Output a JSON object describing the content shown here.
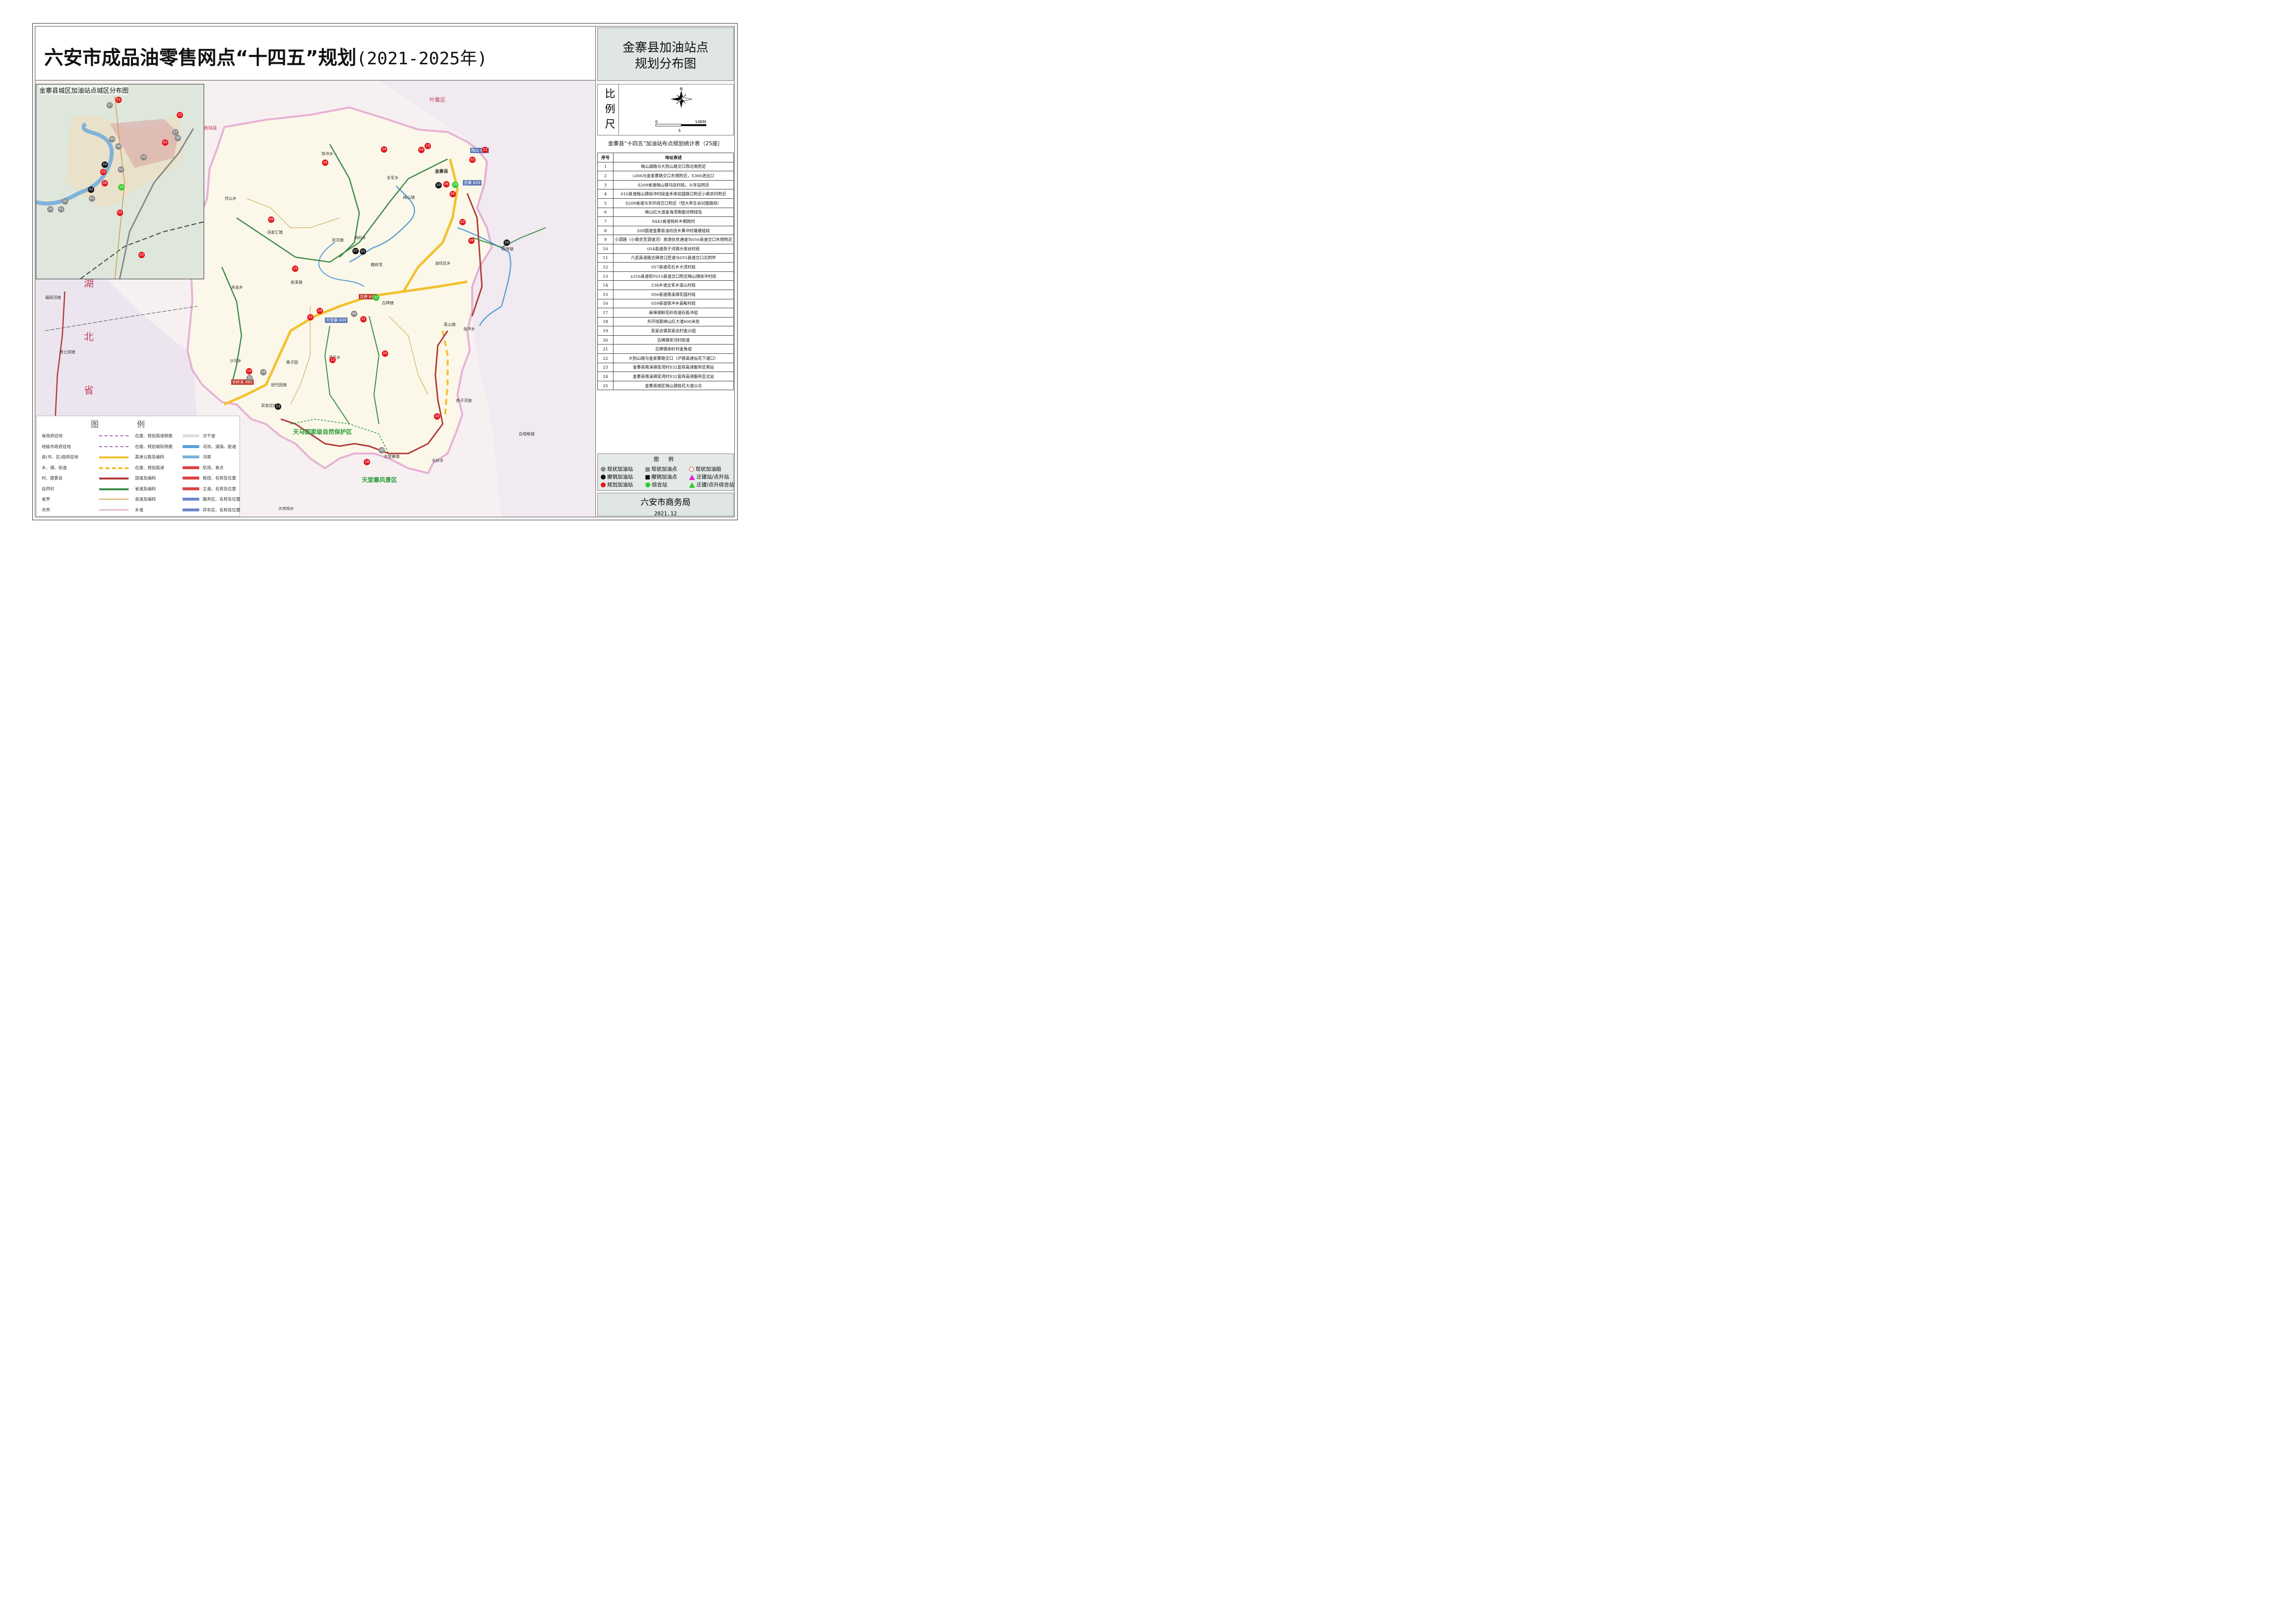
{
  "header": {
    "title": "六安市成品油零售网点“十四五”规划",
    "title_years": "(2021-2025年)",
    "panel_title_line1": "金寨县加油站点",
    "panel_title_line2": "规划分布图"
  },
  "scale": {
    "label_chars": [
      "比",
      "例",
      "尺"
    ],
    "north": "N",
    "ticks": [
      "0",
      "5",
      "10KM"
    ]
  },
  "stats_table": {
    "title": "金寨县“十四五”加油站布点规划统计表（25座）",
    "col_no": "序号",
    "col_addr": "地址表述",
    "rows": [
      {
        "no": "1",
        "addr": "梅山湖路与大别山路交口西北角附近"
      },
      {
        "no": "2",
        "addr": "s366与金家寨路交口东侧附近，S366进出口"
      },
      {
        "no": "3",
        "addr": "S209省道梅山镇马店村段，火车站附近"
      },
      {
        "no": "4",
        "addr": "010县道梅山镇徐冲村段金禾体验园路口附近小南京村附近"
      },
      {
        "no": "5",
        "addr": "S209省道与东环线交口附近（恒大养生谷对面路段）"
      },
      {
        "no": "6",
        "addr": "映山红大道金海湾南面对侧绿岛"
      },
      {
        "no": "7",
        "addr": "S443省道桃岭乡桐岗村"
      },
      {
        "no": "8",
        "addr": "209国道金寨县油坊店乡黄冲村塘埂组段"
      },
      {
        "no": "9",
        "addr": "小泗路（小南京至泗道河）旅游扶贫通道与056县道交口东侧附近"
      },
      {
        "no": "10",
        "addr": "054县道燕子河镇大侠谷村段"
      },
      {
        "no": "11",
        "addr": "六武高速路古碑进口匝道与055县道交口北附件"
      },
      {
        "no": "12",
        "addr": "057县道花石乡大湾村段"
      },
      {
        "no": "13",
        "addr": "x316县道和Y010县道交口附近梅山镇徐冲村段"
      },
      {
        "no": "14",
        "addr": "538乡道全军乡梁山村段"
      },
      {
        "no": "15",
        "addr": "056县道南溪镇花园村段"
      },
      {
        "no": "16",
        "addr": "059县道铁冲乡高畈村段"
      },
      {
        "no": "17",
        "addr": "麻埠镇鲜花岭街道石板冲组"
      },
      {
        "no": "18",
        "addr": "东环线距映山红大道600米处"
      },
      {
        "no": "19",
        "addr": "吴家店镇吴家店村金兴组"
      },
      {
        "no": "20",
        "addr": "古碑镇宋河村街道"
      },
      {
        "no": "21",
        "addr": "古碑镇余岭村金角组"
      },
      {
        "no": "22",
        "addr": "大别山路与金家寨路交口（沪蓉高速仙花下道口）"
      },
      {
        "no": "23",
        "addr": "金寨县南溪镇吴湾村S32宣商高速服务区南站"
      },
      {
        "no": "24",
        "addr": "金寨县南溪镇吴湾村S32宣商高速服务区北站"
      },
      {
        "no": "25",
        "addr": "金寨县城区梅山镇桂花大道以北"
      }
    ]
  },
  "legend_right": {
    "title": "图 例",
    "items": [
      {
        "label": "现状加油站",
        "color": "#8a8a8a"
      },
      {
        "label": "现状加油点",
        "color": "#8a8a8a"
      },
      {
        "label": "现状加油船",
        "color": "#c0392b"
      },
      {
        "label": "撤销加油站",
        "color": "#111111"
      },
      {
        "label": "撤销加油点",
        "color": "#111111"
      },
      {
        "label": "迁建站/点升站",
        "color": "#e020d0"
      },
      {
        "label": "规划加油站",
        "color": "#e4151b"
      },
      {
        "label": "综合站",
        "color": "#2ecc2e"
      },
      {
        "label": "迁建/点升综合站",
        "color": "#2ecc2e"
      }
    ]
  },
  "footer": {
    "org": "六安市商务局",
    "date": "2021.12"
  },
  "inset": {
    "title": "金寨县城区加油站点城区分布图",
    "markers": [
      "01",
      "22",
      "47",
      "37",
      "36",
      "02",
      "40",
      "46",
      "45",
      "42",
      "33",
      "25",
      "06",
      "18",
      "02",
      "31",
      "28",
      "01",
      "03",
      "05",
      "03"
    ]
  },
  "legend_left": {
    "title": "图例",
    "rows": [
      {
        "left": "省政府驻地",
        "mid": "在建、规划高速铁路",
        "right": "次干道"
      },
      {
        "left": "地级市政府驻地",
        "mid": "在建、规划城际铁路",
        "right": "河流、湖海、航道"
      },
      {
        "left": "县(市、区)政府驻地",
        "mid": "高速公路及编码",
        "right": "沟渠"
      },
      {
        "left": "乡、镇、街道",
        "mid": "在建、规划高速",
        "right": "机场、景点"
      },
      {
        "left": "村、居委会",
        "mid": "国道及编码",
        "right": "枢纽、名称及位置"
      },
      {
        "left": "自然村",
        "mid": "省道及编码",
        "right": "主道、名称及位置"
      },
      {
        "left": "省界",
        "mid": "县道及编码",
        "right": "服务区、名称及位置"
      },
      {
        "left": "市界",
        "mid": "乡道",
        "right": "停车区、名称及位置"
      }
    ]
  },
  "map": {
    "region_labels": [
      "湖",
      "北",
      "省"
    ],
    "reserves": [
      "天马国家级自然保护区",
      "天堂寨风景区"
    ],
    "towns": [
      "金寨县",
      "梅山镇",
      "全军乡",
      "铁冲乡",
      "斑竹园镇",
      "沙河乡",
      "关庙乡",
      "汤家汇镇",
      "南溪镇",
      "双河镇",
      "桃岭乡",
      "古碑镇",
      "槐树湾",
      "青山镇",
      "张冲乡",
      "油坊店乡",
      "麻埠镇",
      "燕子河镇",
      "长岭乡",
      "天堂寨镇",
      "吴家店镇",
      "花石乡",
      "果子园",
      "福田河镇",
      "黄土岗镇",
      "伏山乡",
      "白塔畈镇",
      "大地坳乡",
      "商城县",
      "叶集区"
    ],
    "highway_labels": [
      "长岭关 682",
      "天堂寨 649",
      "吉林 644",
      "金寨 609",
      "梅山 608"
    ],
    "markers": [
      {
        "id": "14",
        "type": "r"
      },
      {
        "id": "16",
        "type": "r"
      },
      {
        "id": "13",
        "type": "r"
      },
      {
        "id": "04",
        "type": "r"
      },
      {
        "id": "22",
        "type": "r"
      },
      {
        "id": "02",
        "type": "r"
      },
      {
        "id": "09",
        "type": "r"
      },
      {
        "id": "15",
        "type": "r"
      },
      {
        "id": "24",
        "type": "r"
      },
      {
        "id": "23",
        "type": "r"
      },
      {
        "id": "21",
        "type": "r"
      },
      {
        "id": "12",
        "type": "r"
      },
      {
        "id": "20",
        "type": "r"
      },
      {
        "id": "03",
        "type": "r"
      },
      {
        "id": "08",
        "type": "r"
      },
      {
        "id": "05",
        "type": "r"
      },
      {
        "id": "06",
        "type": "r"
      },
      {
        "id": "10",
        "type": "r"
      },
      {
        "id": "18",
        "type": "r"
      },
      {
        "id": "19",
        "type": "r"
      },
      {
        "id": "11",
        "type": "g"
      },
      {
        "id": "25",
        "type": "g"
      },
      {
        "id": "01",
        "type": "k"
      },
      {
        "id": "33",
        "type": "k"
      },
      {
        "id": "07",
        "type": "k"
      },
      {
        "id": "24",
        "type": "k"
      },
      {
        "id": "23",
        "type": "k"
      },
      {
        "id": "26",
        "type": "y"
      },
      {
        "id": "35",
        "type": "y"
      },
      {
        "id": "48",
        "type": "y"
      },
      {
        "id": "39",
        "type": "y"
      }
    ]
  }
}
